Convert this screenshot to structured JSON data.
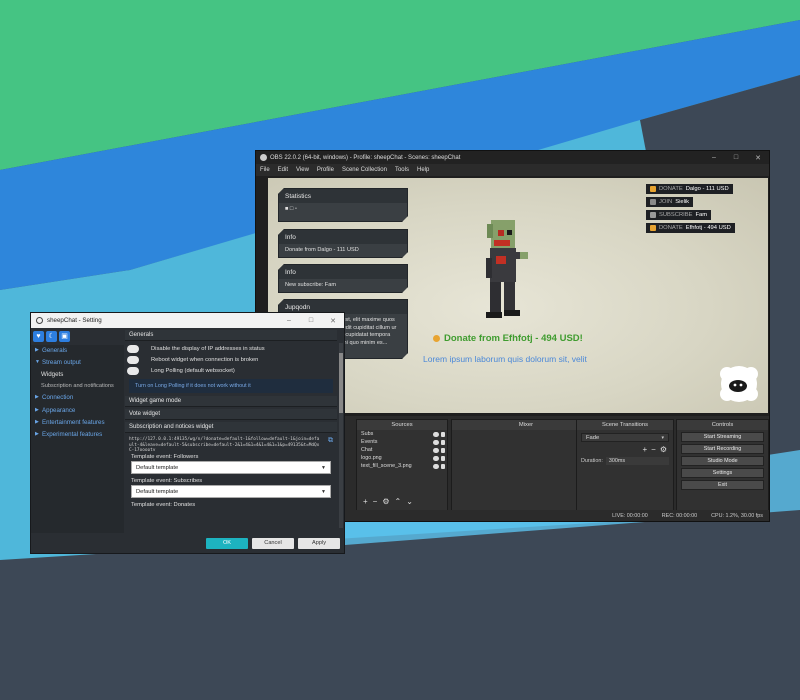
{
  "background": {
    "colors": {
      "green": "#45c483",
      "blue": "#2e86db",
      "teal": "#4fb7da",
      "dark": "#3d4856",
      "light_blue": "#5bc2ee"
    }
  },
  "obs": {
    "title": "OBS 22.0.2 (64-bit, windows) - Profile: sheepChat - Scenes: sheepChat",
    "menu": [
      "File",
      "Edit",
      "View",
      "Profile",
      "Scene Collection",
      "Tools",
      "Help"
    ],
    "scene": {
      "statistics_header": "Statistics",
      "statistics_row": "■ □ ▫",
      "info_header_1": "Info",
      "info_body_1": "Donate from Dalgo - 111 USD",
      "info_header_2": "Info",
      "info_body_2": "New subscribe: Fam",
      "chat_header": "Jupqodn",
      "chat_body": "um dolor est, elit maxime quos dolor dor edit cupiditat cillum ur adipiscing cupidatat tempora\nmporibus hi quo minim es...",
      "alerts": [
        {
          "tag": "DONATE",
          "text": "Dalgo - 111 USD",
          "color": "#e8a431"
        },
        {
          "tag": "JOIN",
          "text": "Sielik",
          "color": "#8a8a8a"
        },
        {
          "tag": "SUBSCRIBE",
          "text": "Fam",
          "color": "#9a9a9a"
        },
        {
          "tag": "DONATE",
          "text": "Efhfotj - 494 USD",
          "color": "#e8a431"
        }
      ],
      "big_donate": "Donate from Efhfotj - 494 USD!",
      "lorem": "Lorem ipsum  laborum quis dolorum sit, velit"
    },
    "docks": {
      "sources_title": "Sources",
      "sources": [
        "Subs",
        "Events",
        "Chat",
        "logo.png",
        "text_fill_scene_3.png"
      ],
      "mixer_title": "Mixer",
      "transitions_title": "Scene Transitions",
      "transition_value": "Fade",
      "duration_label": "Duration",
      "duration_value": "300ms",
      "controls_title": "Controls",
      "controls": [
        "Start Streaming",
        "Start Recording",
        "Studio Mode",
        "Settings",
        "Exit"
      ]
    },
    "status": {
      "live": "LIVE: 00:00:00",
      "rec": "REC: 00:00:00",
      "cpu": "CPU: 1.2%, 30.00 fps"
    }
  },
  "settings": {
    "title": "sheepChat - Setting",
    "icons": [
      "heart-icon",
      "moon-icon",
      "save-icon"
    ],
    "nav": [
      {
        "label": "Generals",
        "kind": "top"
      },
      {
        "label": "Stream output",
        "kind": "top"
      },
      {
        "label": "Widgets",
        "kind": "sub"
      },
      {
        "label": "Subscription and notifications",
        "kind": "muted"
      },
      {
        "label": "Connection",
        "kind": "top"
      },
      {
        "label": "Appearance",
        "kind": "top"
      },
      {
        "label": "Entertainment features",
        "kind": "top"
      },
      {
        "label": "Experimental features",
        "kind": "top"
      }
    ],
    "sections": {
      "generals": "Generals",
      "options": [
        "Disable the display of IP addresses in status",
        "Reboot widget when connection is broken",
        "Long Polling  (default websocket)"
      ],
      "hint": "Turn on Long Polling if it does not work without it",
      "widget_game_mode": "Widget game mode",
      "vote_widget": "Vote widget",
      "subscription_widget": "Subscription and notices widget",
      "url": "http://127.0.0.1:49135/wg/n/?donate=default-1&follow=default-1&join=default-4&leave=default-5&subscribe=default-2&1=4&1=4&1=4&1=1&p=49135&t=MdQxC-17ooopty",
      "followers_label": "Template event: Followers",
      "followers_value": "Default template",
      "subscribes_label": "Template event: Subscribes",
      "subscribes_value": "Default template",
      "donates_label": "Template event: Donates"
    },
    "buttons": {
      "ok": "OK",
      "cancel": "Cancel",
      "apply": "Apply"
    }
  }
}
